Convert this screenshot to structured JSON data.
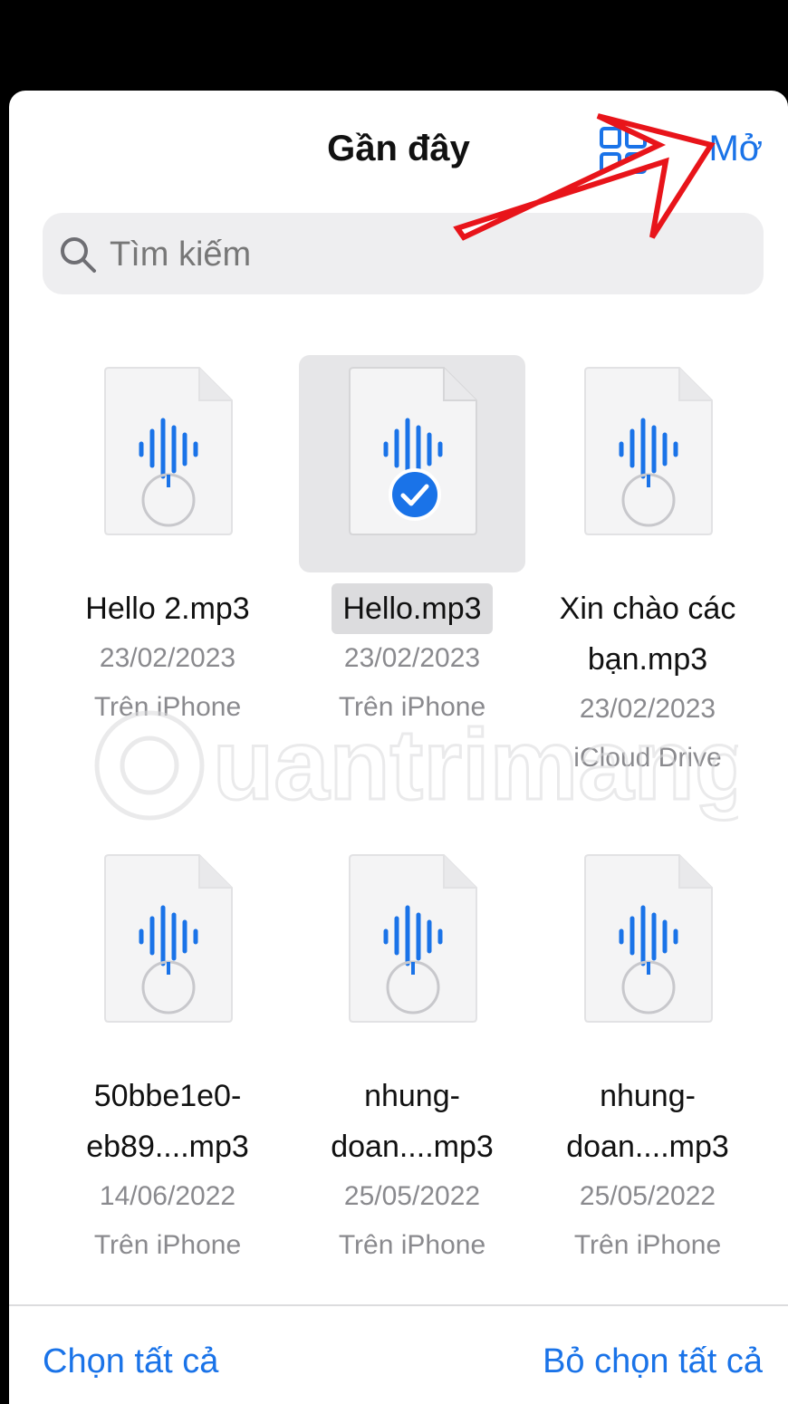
{
  "header": {
    "title": "Gần đây",
    "open_label": "Mở"
  },
  "search": {
    "placeholder": "Tìm kiếm"
  },
  "files": [
    {
      "name": "Hello 2.mp3",
      "date": "23/02/2023",
      "location": "Trên iPhone",
      "selected": false
    },
    {
      "name": "Hello.mp3",
      "date": "23/02/2023",
      "location": "Trên iPhone",
      "selected": true
    },
    {
      "name_line1": "Xin chào các",
      "name_line2": "bạn.mp3",
      "date": "23/02/2023",
      "location": "iCloud Drive",
      "selected": false
    },
    {
      "name_line1": "50bbe1e0-",
      "name_line2": "eb89....mp3",
      "date": "14/06/2022",
      "location": "Trên iPhone",
      "selected": false
    },
    {
      "name_line1": "nhung-",
      "name_line2": "doan....mp3",
      "date": "25/05/2022",
      "location": "Trên iPhone",
      "selected": false
    },
    {
      "name_line1": "nhung-",
      "name_line2": "doan....mp3",
      "date": "25/05/2022",
      "location": "Trên iPhone",
      "selected": false
    }
  ],
  "footer": {
    "select_all": "Chọn tất cả",
    "deselect_all": "Bỏ chọn tất cả"
  },
  "watermark": {
    "text": "uantrimang"
  },
  "colors": {
    "accent": "#1a73e8",
    "annotation_arrow": "#e8141a"
  },
  "icons": {
    "search": "search-icon",
    "view_toggle": "grid-view-icon",
    "file": "audio-file-icon",
    "check": "checkmark-circle-icon"
  }
}
